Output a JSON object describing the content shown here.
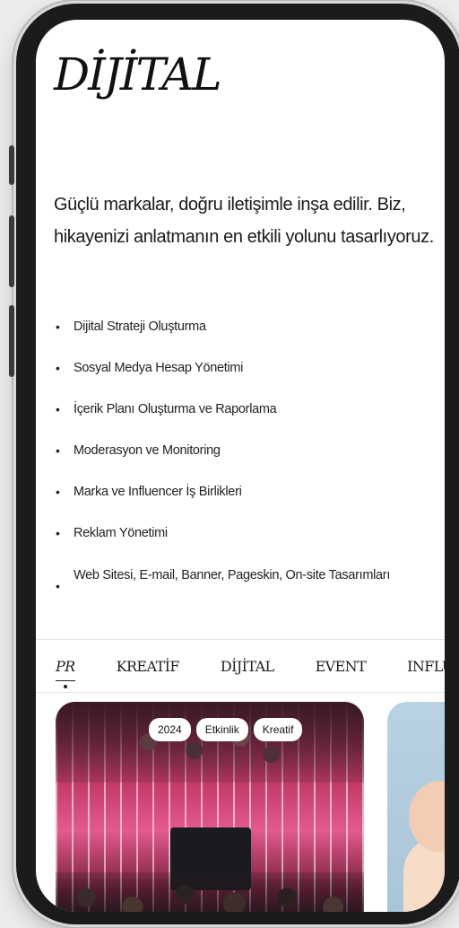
{
  "brand": {
    "logo_text": "DİJİTAL"
  },
  "intro": {
    "text": "Güçlü markalar, doğru iletişimle inşa edilir. Biz, hikayenizi anlatmanın en etkili yolunu tasarlıyoruz."
  },
  "services": [
    "Dijital Strateji Oluşturma",
    "Sosyal Medya Hesap Yönetimi",
    "İçerik Planı Oluşturma ve Raporlama",
    "Moderasyon ve Monitoring",
    "Marka ve Influencer İş Birlikleri",
    "Reklam Yönetimi",
    "Web Sitesi, E-mail, Banner, Pageskin, On-site Tasarımları"
  ],
  "tabs": [
    "PR",
    "KREATİF",
    "DİJİTAL",
    "EVENT",
    "INFLU"
  ],
  "active_tab": "PR",
  "card": {
    "tags": [
      "2024",
      "Etkinlik",
      "Kreatif"
    ]
  },
  "colors": {
    "background": "#ffffff",
    "text": "#1a1a1a",
    "frame": "#1b1b1d"
  },
  "icons": [
    "bullet-icon"
  ]
}
